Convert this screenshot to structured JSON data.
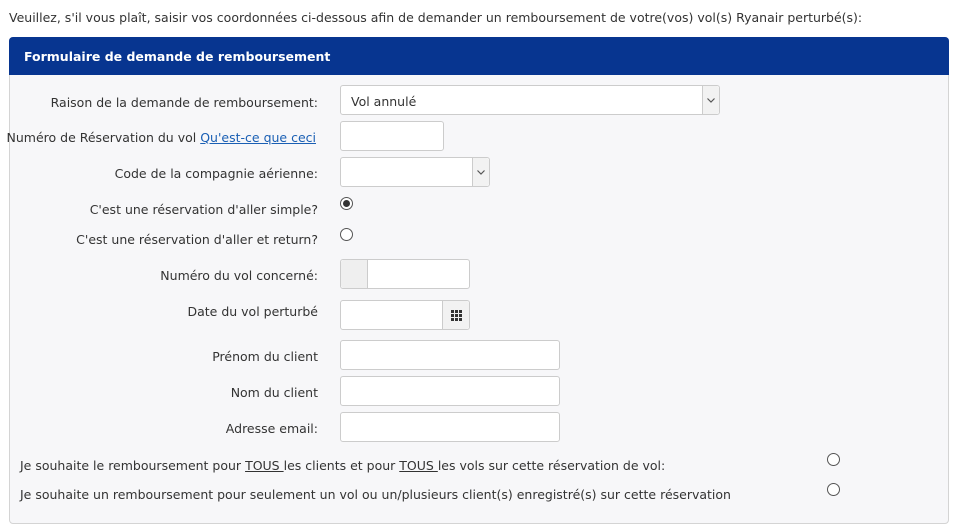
{
  "intro_text": "Veuillez, s'il vous plaît, saisir vos coordonnées ci-dessous afin de demander un remboursement de votre(vos) vol(s) Ryanair perturbé(s):",
  "panel": {
    "title": "Formulaire de demande de remboursement"
  },
  "form": {
    "reason": {
      "label": "Raison de la demande de remboursement:",
      "value": "Vol annulé"
    },
    "booking": {
      "label": "Numéro de Réservation du vol",
      "link": "Qu'est-ce que ceci",
      "value": ""
    },
    "airline_code": {
      "label": "Code de la compagnie aérienne:",
      "value": ""
    },
    "one_way": {
      "label": "C'est une réservation d'aller simple?",
      "checked": true
    },
    "return": {
      "label": "C'est une réservation d'aller et return?",
      "checked": false
    },
    "flight_number": {
      "label": "Numéro du vol concerné:",
      "value": ""
    },
    "flight_date": {
      "label": "Date du vol perturbé",
      "value": ""
    },
    "first_name": {
      "label": "Prénom du client",
      "value": ""
    },
    "last_name": {
      "label": "Nom du client",
      "value": ""
    },
    "email": {
      "label": "Adresse email:",
      "value": ""
    }
  },
  "refund_all": {
    "part1": "Je souhaite le remboursement pour ",
    "tous1": "TOUS ",
    "part2": "les clients et pour ",
    "tous2": "TOUS ",
    "part3": "les vols sur cette réservation de vol:"
  },
  "refund_partial": {
    "text": "Je souhaite un remboursement pour seulement un vol ou un/plusieurs client(s) enregistré(s) sur cette réservation"
  },
  "icons": {
    "select_caret": "chevron-down-icon",
    "calendar": "calendar-grid-icon"
  }
}
